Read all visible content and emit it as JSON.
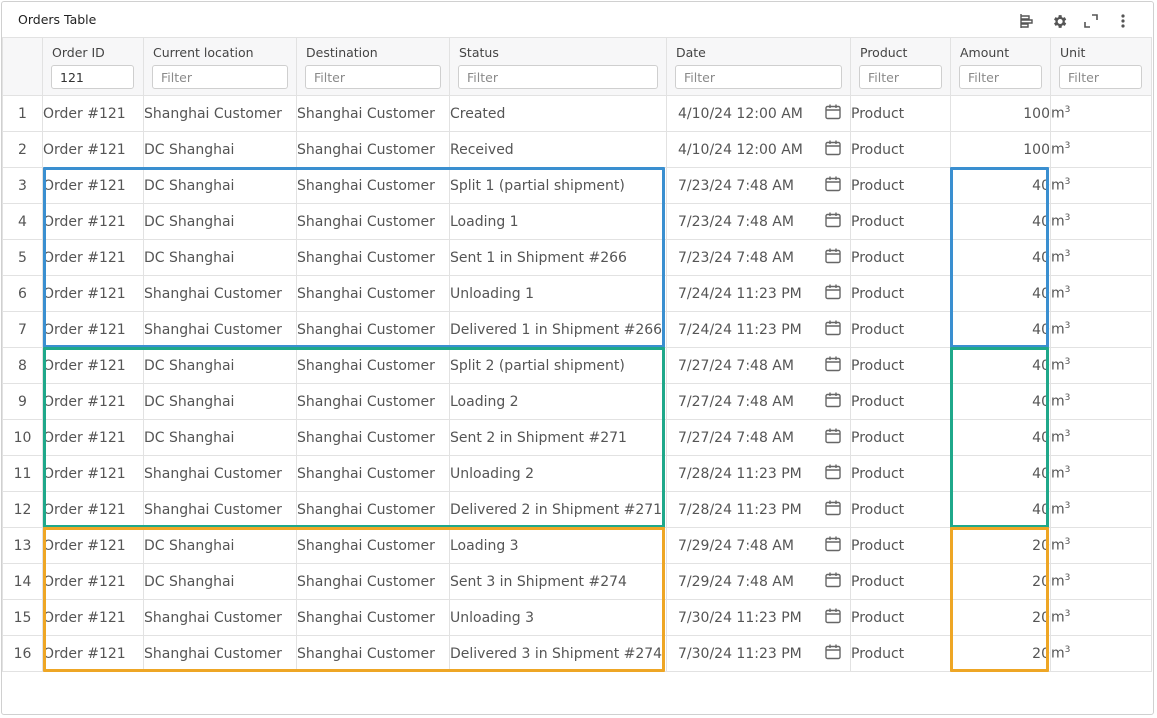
{
  "window": {
    "title": "Orders Table"
  },
  "toolbar": {
    "icons": [
      "column-chooser-icon",
      "settings-gear-icon",
      "expand-icon",
      "more-vertical-icon"
    ]
  },
  "columns": [
    {
      "label": "Order ID",
      "filter_value": "121",
      "placeholder": "Filter"
    },
    {
      "label": "Current location",
      "filter_value": "",
      "placeholder": "Filter"
    },
    {
      "label": "Destination",
      "filter_value": "",
      "placeholder": "Filter"
    },
    {
      "label": "Status",
      "filter_value": "",
      "placeholder": "Filter"
    },
    {
      "label": "Date",
      "filter_value": "",
      "placeholder": "Filter"
    },
    {
      "label": "Product",
      "filter_value": "",
      "placeholder": "Filter"
    },
    {
      "label": "Amount",
      "filter_value": "",
      "placeholder": "Filter"
    },
    {
      "label": "Unit",
      "filter_value": "",
      "placeholder": "Filter"
    }
  ],
  "rows": [
    {
      "num": "1",
      "order": "Order #121",
      "location": "Shanghai Customer",
      "destination": "Shanghai Customer",
      "status": "Created",
      "date": "4/10/24 12:00 AM",
      "product": "Product",
      "amount": "100",
      "unit": "m",
      "unit_sup": "3"
    },
    {
      "num": "2",
      "order": "Order #121",
      "location": "DC Shanghai",
      "destination": "Shanghai Customer",
      "status": "Received",
      "date": "4/10/24 12:00 AM",
      "product": "Product",
      "amount": "100",
      "unit": "m",
      "unit_sup": "3"
    },
    {
      "num": "3",
      "order": "Order #121",
      "location": "DC Shanghai",
      "destination": "Shanghai Customer",
      "status": "Split 1 (partial shipment)",
      "date": "7/23/24 7:48 AM",
      "product": "Product",
      "amount": "40",
      "unit": "m",
      "unit_sup": "3"
    },
    {
      "num": "4",
      "order": "Order #121",
      "location": "DC Shanghai",
      "destination": "Shanghai Customer",
      "status": "Loading 1",
      "date": "7/23/24 7:48 AM",
      "product": "Product",
      "amount": "40",
      "unit": "m",
      "unit_sup": "3"
    },
    {
      "num": "5",
      "order": "Order #121",
      "location": "DC Shanghai",
      "destination": "Shanghai Customer",
      "status": "Sent 1 in Shipment #266",
      "date": "7/23/24 7:48 AM",
      "product": "Product",
      "amount": "40",
      "unit": "m",
      "unit_sup": "3"
    },
    {
      "num": "6",
      "order": "Order #121",
      "location": "Shanghai Customer",
      "destination": "Shanghai Customer",
      "status": "Unloading 1",
      "date": "7/24/24 11:23 PM",
      "product": "Product",
      "amount": "40",
      "unit": "m",
      "unit_sup": "3"
    },
    {
      "num": "7",
      "order": "Order #121",
      "location": "Shanghai Customer",
      "destination": "Shanghai Customer",
      "status": "Delivered 1 in Shipment #266",
      "date": "7/24/24 11:23 PM",
      "product": "Product",
      "amount": "40",
      "unit": "m",
      "unit_sup": "3"
    },
    {
      "num": "8",
      "order": "Order #121",
      "location": "DC Shanghai",
      "destination": "Shanghai Customer",
      "status": "Split 2 (partial shipment)",
      "date": "7/27/24 7:48 AM",
      "product": "Product",
      "amount": "40",
      "unit": "m",
      "unit_sup": "3"
    },
    {
      "num": "9",
      "order": "Order #121",
      "location": "DC Shanghai",
      "destination": "Shanghai Customer",
      "status": "Loading 2",
      "date": "7/27/24 7:48 AM",
      "product": "Product",
      "amount": "40",
      "unit": "m",
      "unit_sup": "3"
    },
    {
      "num": "10",
      "order": "Order #121",
      "location": "DC Shanghai",
      "destination": "Shanghai Customer",
      "status": "Sent 2 in Shipment #271",
      "date": "7/27/24 7:48 AM",
      "product": "Product",
      "amount": "40",
      "unit": "m",
      "unit_sup": "3"
    },
    {
      "num": "11",
      "order": "Order #121",
      "location": "Shanghai Customer",
      "destination": "Shanghai Customer",
      "status": "Unloading 2",
      "date": "7/28/24 11:23 PM",
      "product": "Product",
      "amount": "40",
      "unit": "m",
      "unit_sup": "3"
    },
    {
      "num": "12",
      "order": "Order #121",
      "location": "Shanghai Customer",
      "destination": "Shanghai Customer",
      "status": "Delivered 2 in Shipment #271",
      "date": "7/28/24 11:23 PM",
      "product": "Product",
      "amount": "40",
      "unit": "m",
      "unit_sup": "3"
    },
    {
      "num": "13",
      "order": "Order #121",
      "location": "DC Shanghai",
      "destination": "Shanghai Customer",
      "status": "Loading 3",
      "date": "7/29/24 7:48 AM",
      "product": "Product",
      "amount": "20",
      "unit": "m",
      "unit_sup": "3"
    },
    {
      "num": "14",
      "order": "Order #121",
      "location": "DC Shanghai",
      "destination": "Shanghai Customer",
      "status": "Sent 3 in Shipment #274",
      "date": "7/29/24 7:48 AM",
      "product": "Product",
      "amount": "20",
      "unit": "m",
      "unit_sup": "3"
    },
    {
      "num": "15",
      "order": "Order #121",
      "location": "Shanghai Customer",
      "destination": "Shanghai Customer",
      "status": "Unloading 3",
      "date": "7/30/24 11:23 PM",
      "product": "Product",
      "amount": "20",
      "unit": "m",
      "unit_sup": "3"
    },
    {
      "num": "16",
      "order": "Order #121",
      "location": "Shanghai Customer",
      "destination": "Shanghai Customer",
      "status": "Delivered 3 in Shipment #274",
      "date": "7/30/24 11:23 PM",
      "product": "Product",
      "amount": "20",
      "unit": "m",
      "unit_sup": "3"
    }
  ],
  "highlights": {
    "colors": {
      "shipment_1": "#3a8fd0",
      "shipment_2": "#1fa88a",
      "shipment_3": "#eea625"
    }
  }
}
